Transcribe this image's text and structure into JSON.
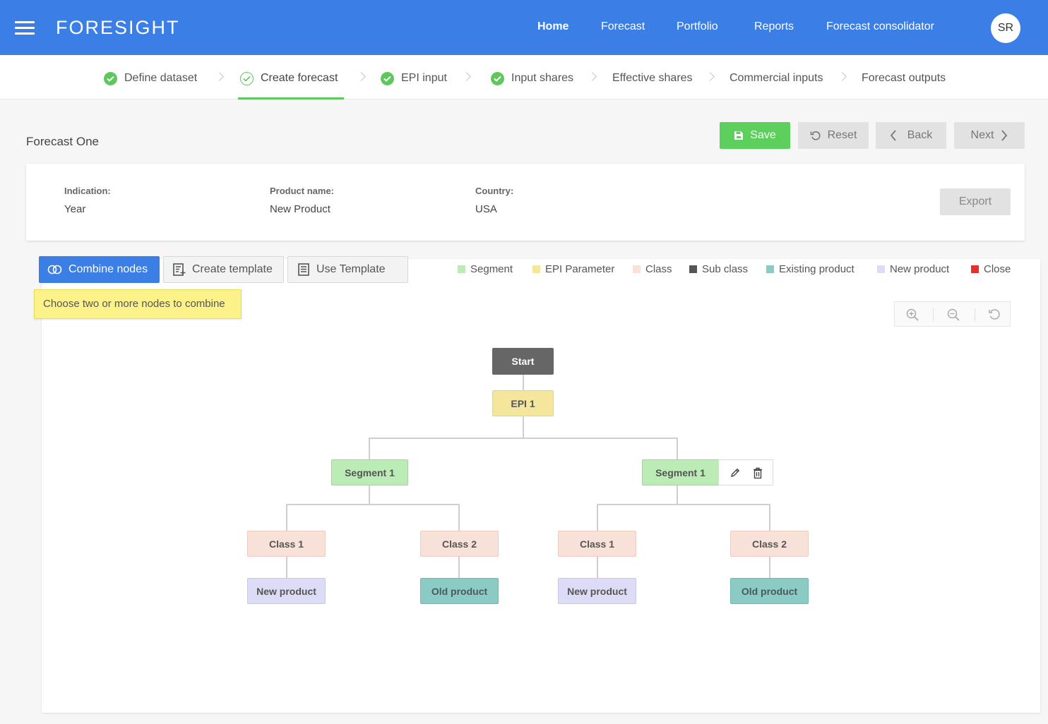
{
  "header": {
    "brand": "FORESIGHT",
    "nav": [
      "Home",
      "Forecast",
      "Portfolio",
      "Reports",
      "Forecast consolidator"
    ],
    "active_nav": "Home",
    "avatar_initials": "SR",
    "color": "#3a7ee6"
  },
  "stepper": {
    "steps": [
      {
        "label": "Define dataset",
        "status": "complete"
      },
      {
        "label": "Create forecast",
        "status": "current"
      },
      {
        "label": "EPI input",
        "status": "complete"
      },
      {
        "label": "Input shares",
        "status": "complete"
      },
      {
        "label": "Effective shares",
        "status": "pending"
      },
      {
        "label": "Commercial inputs",
        "status": "pending"
      },
      {
        "label": "Forecast outputs",
        "status": "pending"
      }
    ]
  },
  "page": {
    "title": "Forecast One",
    "actions": {
      "save": "Save",
      "reset": "Reset",
      "back": "Back",
      "next": "Next"
    }
  },
  "info": {
    "indication_label": "Indication:",
    "indication_value": "Year",
    "product_label": "Product name:",
    "product_value": "New Product",
    "country_label": "Country:",
    "country_value": "USA",
    "export": "Export"
  },
  "toolbar": {
    "combine": "Combine nodes",
    "create_template": "Create template",
    "use_template": "Use Template",
    "hint": "Choose two or more nodes to combine"
  },
  "legend": [
    {
      "label": "Segment",
      "color": "#bbecb6"
    },
    {
      "label": "EPI Parameter",
      "color": "#f4e79c"
    },
    {
      "label": "Class",
      "color": "#f8e1d8"
    },
    {
      "label": "Sub class",
      "color": "#555555"
    },
    {
      "label": "Existing product",
      "color": "#8acbc6"
    },
    {
      "label": "New product",
      "color": "#dddcf6"
    },
    {
      "label": "Close",
      "color": "#e53030"
    }
  ],
  "tree": {
    "start": "Start",
    "epi": "EPI 1",
    "segments": [
      {
        "label": "Segment 1",
        "classes": [
          {
            "label": "Class 1",
            "product": "New product"
          },
          {
            "label": "Class 2",
            "product": "Old product"
          }
        ]
      },
      {
        "label": "Segment 1",
        "classes": [
          {
            "label": "Class 1",
            "product": "New product"
          },
          {
            "label": "Class 2",
            "product": "Old product"
          }
        ]
      }
    ]
  }
}
